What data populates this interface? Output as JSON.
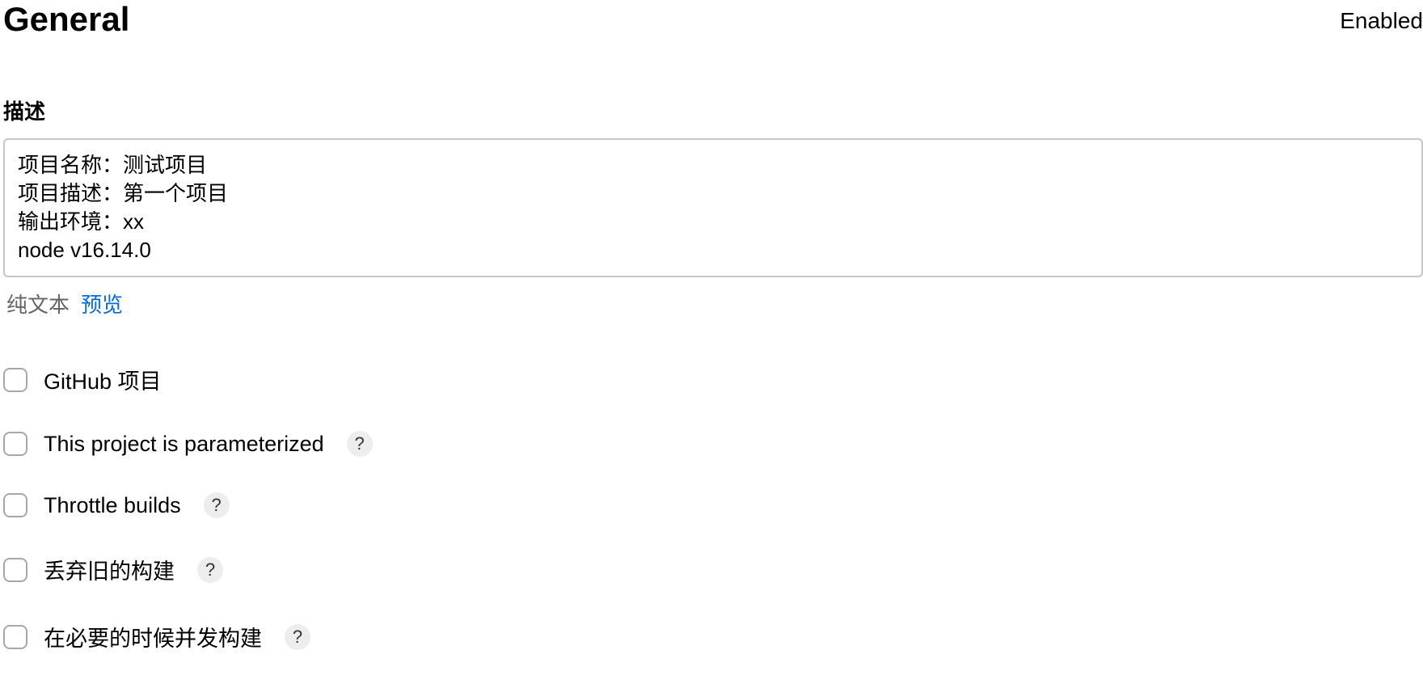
{
  "header": {
    "title": "General",
    "status": "Enabled"
  },
  "description": {
    "label": "描述",
    "value": "项目名称：测试项目\n项目描述：第一个项目\n输出环境：xx\nnode v16.14.0",
    "view_modes": {
      "plain": "纯文本",
      "preview": "预览"
    }
  },
  "options": [
    {
      "label": "GitHub 项目",
      "has_help": false,
      "checked": false
    },
    {
      "label": "This project is parameterized",
      "has_help": true,
      "checked": false
    },
    {
      "label": "Throttle builds",
      "has_help": true,
      "checked": false
    },
    {
      "label": "丢弃旧的构建",
      "has_help": true,
      "checked": false
    },
    {
      "label": "在必要的时候并发构建",
      "has_help": true,
      "checked": false
    }
  ],
  "help_glyph": "?"
}
